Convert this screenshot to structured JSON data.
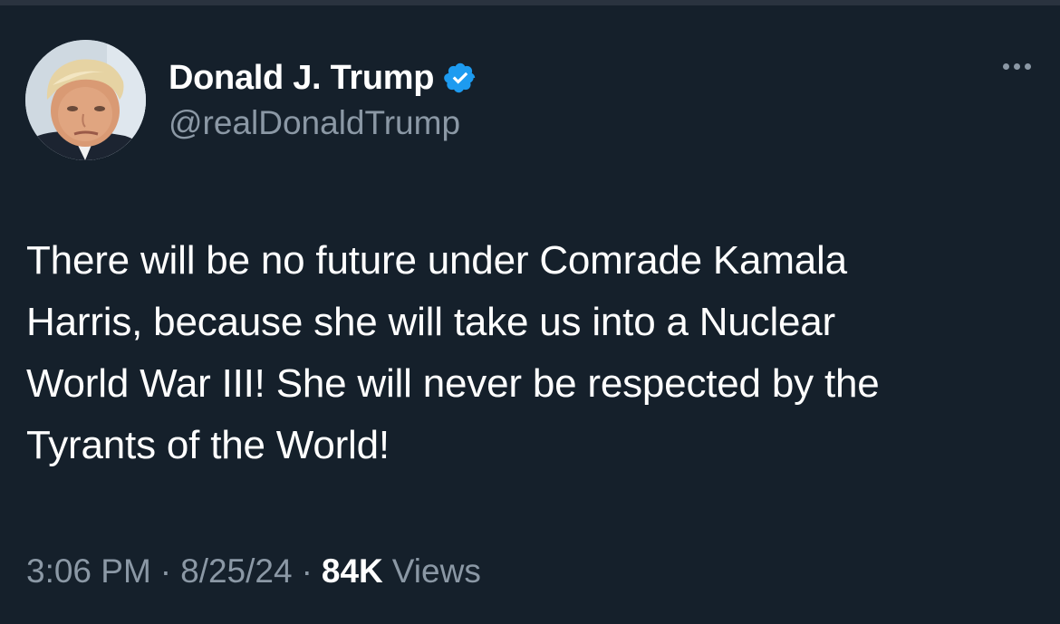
{
  "author": {
    "name": "Donald J. Trump",
    "handle": "@realDonaldTrump",
    "verified": true,
    "verified_color": "#1d9bf0"
  },
  "tweet": {
    "text": "There will be no future under Comrade Kamala\nHarris, because she will take us into a Nuclear\nWorld War III! She will never be respected by the\nTyrants of the World!",
    "time": "3:06 PM",
    "separator": "·",
    "date": "8/25/24",
    "views_count": "84K",
    "views_label": "Views"
  },
  "icons": {
    "more": "more-horizontal-icon",
    "verified": "verified-badge-icon"
  },
  "colors": {
    "background": "#15202b",
    "secondary_text": "#8b98a5",
    "primary_text": "#ffffff"
  }
}
